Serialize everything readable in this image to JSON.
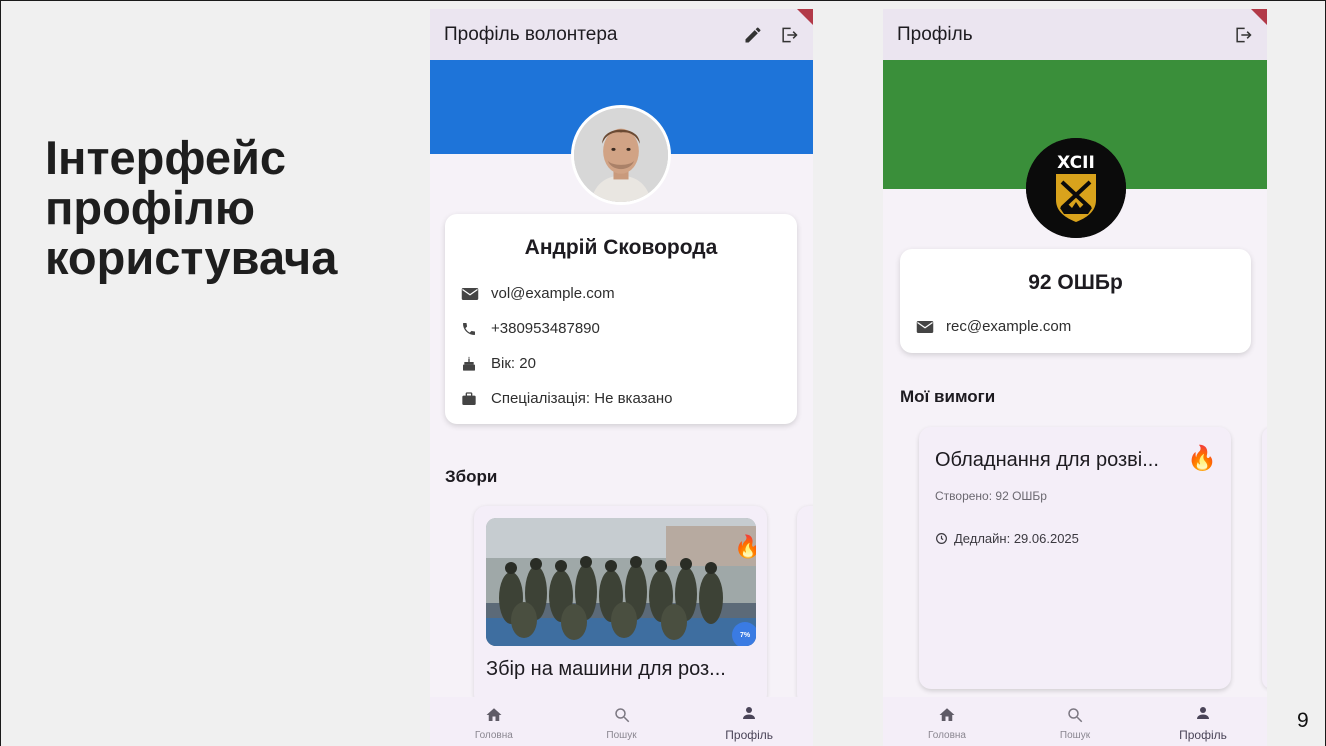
{
  "slide": {
    "title_lines": [
      "Інтерфейс",
      "профілю",
      "користувача"
    ],
    "page_number": "9"
  },
  "volunteer": {
    "appbar_title": "Профіль волонтера",
    "name": "Андрій Сковорода",
    "email": "vol@example.com",
    "phone": "+380953487890",
    "age": "Вік: 20",
    "specialization": "Спеціалізація: Не вказано",
    "section_title": "Збори",
    "fund": {
      "title": "Збір на машини для роз...",
      "progress_label": "7%",
      "progress": 0.07
    }
  },
  "unit": {
    "appbar_title": "Профіль",
    "name": "92 ОШБр",
    "email": "rec@example.com",
    "logo_text": "XCII",
    "section_title": "Мої вимоги",
    "requirement": {
      "title": "Обладнання для розві...",
      "created": "Створено: 92 ОШБр",
      "deadline": "Дедлайн: 29.06.2025"
    }
  },
  "nav": {
    "home": "Головна",
    "search": "Пошук",
    "profile": "Профіль"
  },
  "colors": {
    "volunteer_banner": "#1e74d9",
    "unit_banner": "#3a8f3a",
    "appbar": "#ebe5f0",
    "progress_badge": "#3a7be3"
  }
}
